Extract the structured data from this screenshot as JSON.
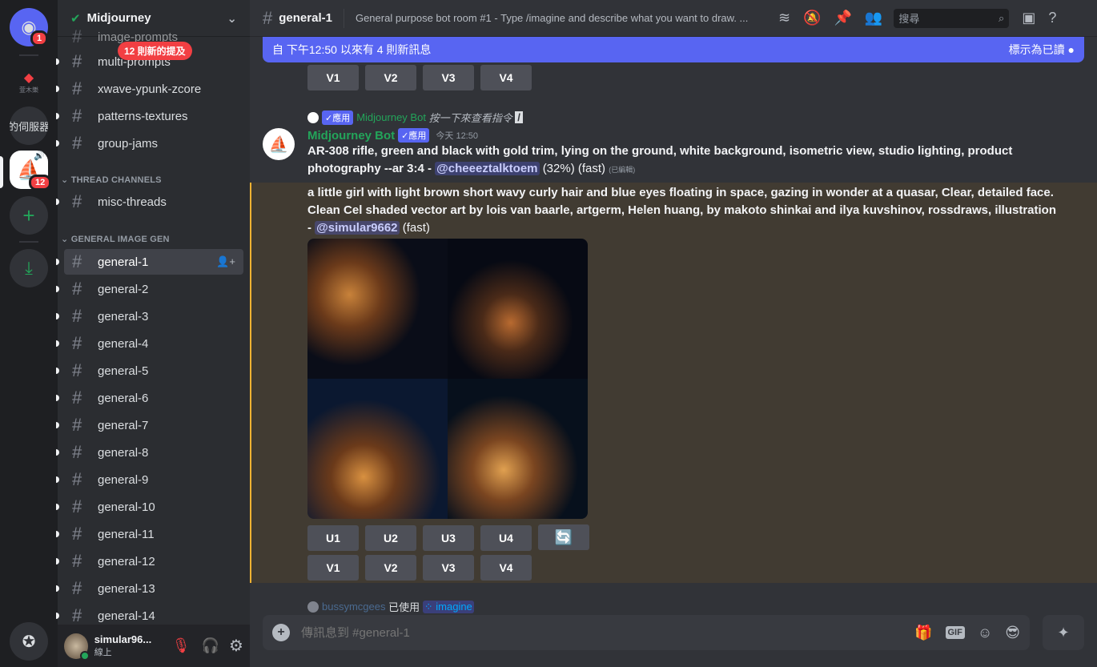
{
  "servers": {
    "home_badge": "1",
    "server2_label": "萱木樂",
    "server3_label": "的伺服器",
    "midjourney_badge": "12"
  },
  "guild": {
    "name": "Midjourney",
    "mentions_pill": "12 則新的提及"
  },
  "channels": [
    {
      "name": "image-prompts"
    },
    {
      "name": "multi-prompts"
    },
    {
      "name": "xwave-ypunk-zcore"
    },
    {
      "name": "patterns-textures"
    },
    {
      "name": "group-jams"
    }
  ],
  "categories": {
    "thread": "THREAD CHANNELS",
    "general": "GENERAL IMAGE GEN"
  },
  "thread_channels": [
    {
      "name": "misc-threads"
    }
  ],
  "general_channels": [
    "general-1",
    "general-2",
    "general-3",
    "general-4",
    "general-5",
    "general-6",
    "general-7",
    "general-8",
    "general-9",
    "general-10",
    "general-11",
    "general-12",
    "general-13",
    "general-14"
  ],
  "user": {
    "name": "simular96...",
    "status": "線上"
  },
  "header": {
    "channel": "general-1",
    "topic": "General purpose bot room #1 - Type /imagine and describe what you want to draw. ...",
    "search_placeholder": "搜尋"
  },
  "banner": {
    "text": "自 下午12:50 以來有 4 則新訊息",
    "mark_read": "標示為已讀"
  },
  "buttons": {
    "u": [
      "U1",
      "U2",
      "U3",
      "U4"
    ],
    "v": [
      "V1",
      "V2",
      "V3",
      "V4"
    ]
  },
  "message1": {
    "reply_app": "✓應用",
    "reply_name": "Midjourney Bot",
    "reply_text": "按一下來查看指令",
    "author": "Midjourney Bot",
    "app_tag": "✓應用",
    "time": "今天 12:50",
    "prompt": "AR-308 rifle, green and black with gold trim, lying on the ground, white background, isometric view, studio lighting, product photography --ar 3:4 - ",
    "mention": "@cheeeztalktoem",
    "suffix": "(32%) (fast)",
    "edited": "(已編輯)"
  },
  "message2": {
    "prompt": "a little girl with light brown short wavy curly hair and blue eyes floating in space, gazing in wonder at a quasar, Clear, detailed face. Clean Cel shaded vector art by lois van baarle, artgerm, Helen huang, by makoto shinkai and ilya kuvshinov, rossdraws, illustration - ",
    "mention": "@simular9662",
    "suffix": "(fast)"
  },
  "reply3": {
    "name": "bussymcgees",
    "used": "已使用",
    "command": "imagine"
  },
  "composer": {
    "placeholder": "傳訊息到 #general-1"
  },
  "colors": {
    "accent": "#5865f2",
    "bot_name": "#23a55a",
    "highlight_border": "#f0b232"
  }
}
